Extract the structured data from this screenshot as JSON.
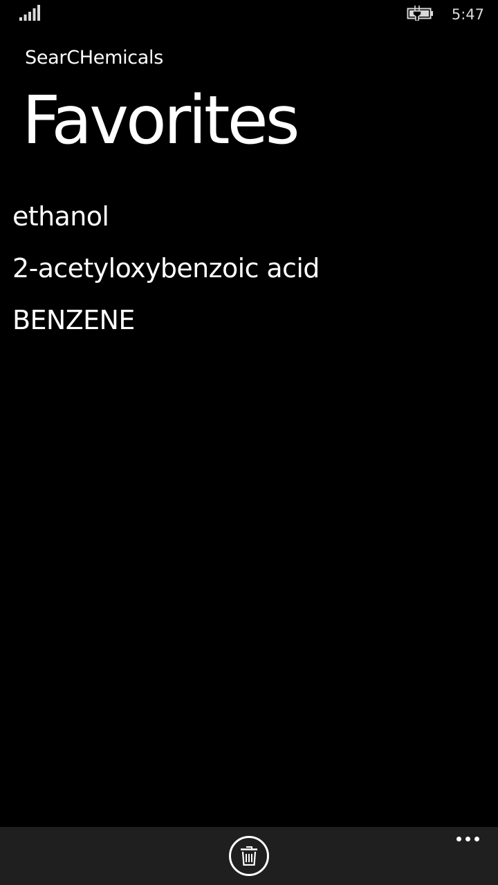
{
  "status_bar": {
    "time": "5:47",
    "signal_icon": "signal-strength-icon",
    "battery_icon": "battery-charging-icon"
  },
  "header": {
    "app_name": "SearCHemicals",
    "page_title": "Favorites"
  },
  "favorites": [
    {
      "label": "ethanol"
    },
    {
      "label": "2-acetyloxybenzoic acid"
    },
    {
      "label": "BENZENE"
    }
  ],
  "app_bar": {
    "delete_icon": "trash-icon",
    "more_icon": "more-options-icon",
    "background": "#1f1f1f"
  },
  "colors": {
    "background": "#000000",
    "foreground": "#ffffff"
  }
}
